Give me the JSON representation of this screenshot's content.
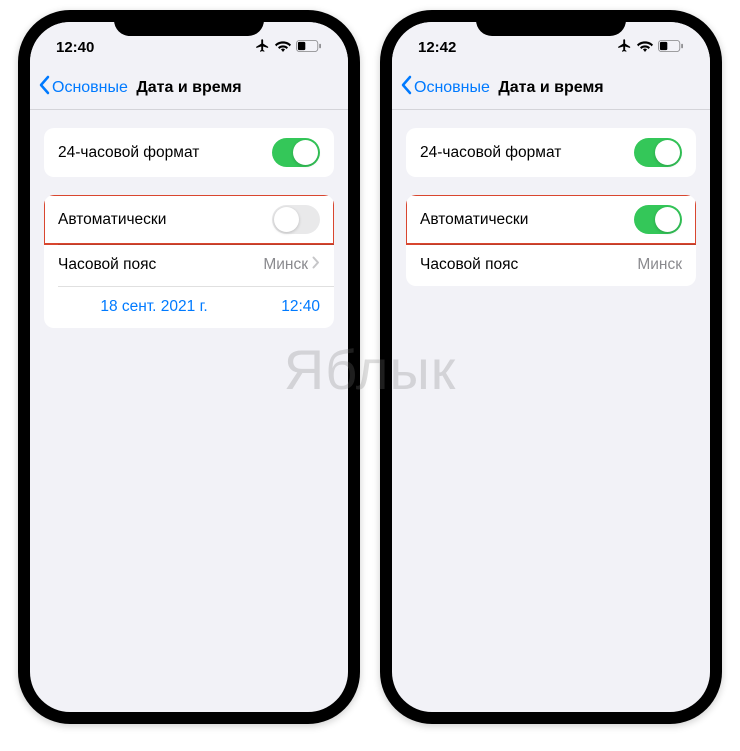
{
  "watermark": "Яблык",
  "left": {
    "status_time": "12:40",
    "back_label": "Основные",
    "title": "Дата и время",
    "row_24h": "24-часовой формат",
    "row_auto": "Автоматически",
    "row_tz_label": "Часовой пояс",
    "row_tz_value": "Минск",
    "picker_date": "18 сент. 2021 г.",
    "picker_time": "12:40",
    "auto_on": false
  },
  "right": {
    "status_time": "12:42",
    "back_label": "Основные",
    "title": "Дата и время",
    "row_24h": "24-часовой формат",
    "row_auto": "Автоматически",
    "row_tz_label": "Часовой пояс",
    "row_tz_value": "Минск",
    "auto_on": true
  }
}
